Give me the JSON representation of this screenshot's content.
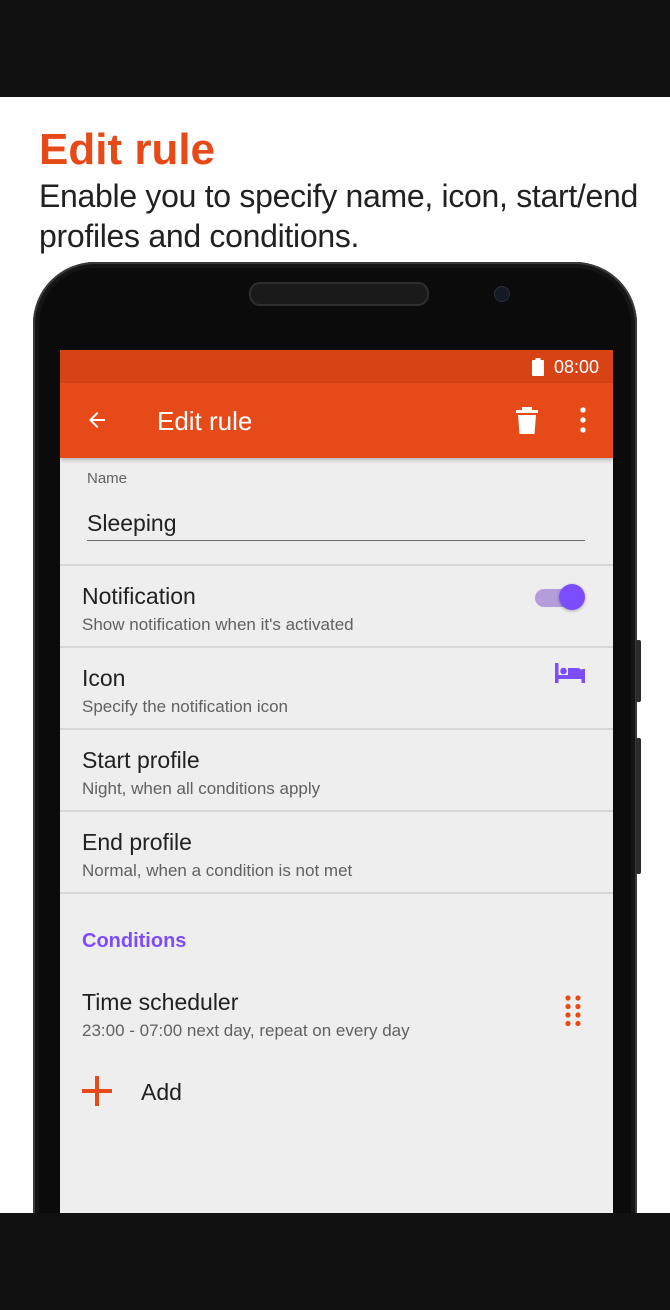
{
  "promo": {
    "title": "Edit rule",
    "description": "Enable you to specify name, icon, start/end profiles and conditions."
  },
  "status_bar": {
    "time": "08:00",
    "battery_icon": "battery-full-icon"
  },
  "app_bar": {
    "title": "Edit rule",
    "back_icon": "arrow-back-icon",
    "delete_icon": "trash-icon",
    "more_icon": "more-vert-icon"
  },
  "name_field": {
    "label": "Name",
    "value": "Sleeping"
  },
  "settings": {
    "notification": {
      "title": "Notification",
      "subtitle": "Show notification when it's activated",
      "enabled": true
    },
    "icon": {
      "title": "Icon",
      "subtitle": "Specify the notification icon",
      "icon": "bed-icon"
    },
    "start_profile": {
      "title": "Start profile",
      "subtitle": "Night, when all conditions apply"
    },
    "end_profile": {
      "title": "End profile",
      "subtitle": "Normal, when a condition is not met"
    }
  },
  "conditions": {
    "header": "Conditions",
    "items": [
      {
        "title": "Time scheduler",
        "subtitle": "23:00 - 07:00 next day, repeat on every day",
        "handle_icon": "drag-handle-icon"
      }
    ],
    "add_label": "Add"
  },
  "colors": {
    "accent": "#e64a19",
    "status_bar": "#d84315",
    "highlight": "#7c4dff"
  }
}
